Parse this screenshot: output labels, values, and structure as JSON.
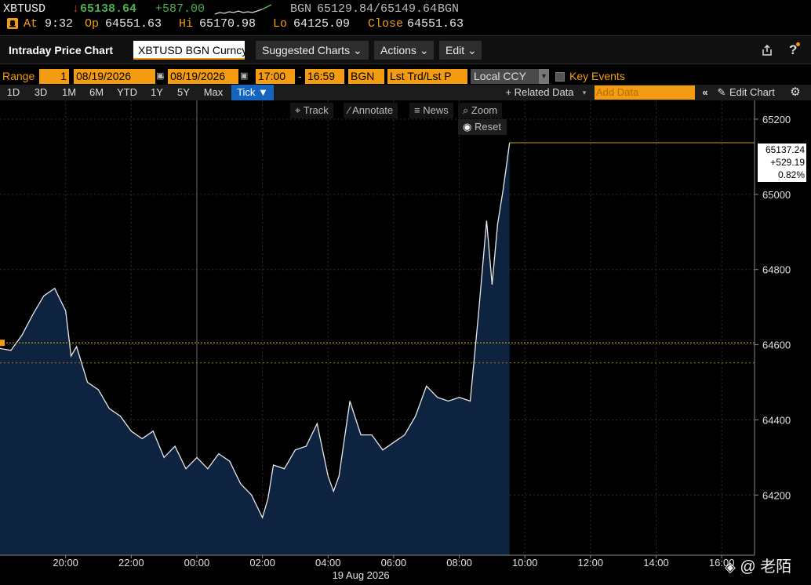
{
  "ticker": {
    "symbol": "XBTUSD",
    "arrow": "↓",
    "last": "65138.64",
    "change": "+587.00",
    "source": "BGN",
    "bid_ask": "65129.84/65149.64",
    "source2": "BGN",
    "at_label": "At",
    "at_time": "9:32",
    "open_label": "Op",
    "open": "64551.63",
    "high_label": "Hi",
    "high": "65170.98",
    "low_label": "Lo",
    "low": "64125.09",
    "close_label": "Close",
    "close": "64551.63"
  },
  "titlebar": {
    "title": "Intraday Price Chart",
    "security": "XBTUSD BGN Curncy",
    "suggested": "Suggested Charts",
    "actions": "Actions",
    "edit": "Edit",
    "help": "?"
  },
  "rangebar": {
    "range_label": "Range",
    "range_num": "1",
    "date_start": "08/19/2026",
    "date_sep": "-",
    "date_end": "08/19/2026",
    "time_start": "17:00",
    "time_sep": "-",
    "time_end": "16:59",
    "source": "BGN",
    "mode": "Lst Trd/Lst P",
    "ccy": "Local CCY",
    "key_events": "Key Events"
  },
  "periodbar": {
    "periods": [
      "1D",
      "3D",
      "1M",
      "6M",
      "YTD",
      "1Y",
      "5Y",
      "Max"
    ],
    "active": "Tick ▼",
    "related": "+ Related Data",
    "add_data_placeholder": "Add Data",
    "edit_chart": "Edit Chart"
  },
  "tools": {
    "track": "Track",
    "annotate": "Annotate",
    "news": "News",
    "zoom": "Zoom",
    "reset": "Reset"
  },
  "watermark": "@ 老陌",
  "colors": {
    "accent_orange": "#f39c12",
    "last_price_line": "#d4a017",
    "area_fill": "#0e2340",
    "price_line": "#e8e8e8",
    "up_green": "#4caf50",
    "down_red": "#e03a2e"
  },
  "chart_data": {
    "type": "area",
    "series": [
      {
        "x": [
          "18:00",
          "18:20",
          "18:40",
          "19:00",
          "19:20",
          "19:40",
          "20:00",
          "20:10",
          "20:20",
          "20:40",
          "21:00",
          "21:20",
          "21:40",
          "22:00",
          "22:20",
          "22:40",
          "23:00",
          "23:20",
          "23:40",
          "00:00",
          "00:20",
          "00:40",
          "01:00",
          "01:20",
          "01:40",
          "02:00",
          "02:10",
          "02:20",
          "02:40",
          "03:00",
          "03:20",
          "03:40",
          "04:00",
          "04:10",
          "04:20",
          "04:40",
          "05:00",
          "05:20",
          "05:40",
          "06:00",
          "06:20",
          "06:40",
          "07:00",
          "07:20",
          "07:40",
          "08:00",
          "08:20",
          "08:35",
          "08:50",
          "09:00",
          "09:10",
          "09:20",
          "09:32"
        ],
        "values": [
          64590,
          64585,
          64625,
          64680,
          64730,
          64750,
          64690,
          64570,
          64595,
          64500,
          64480,
          64430,
          64410,
          64370,
          64350,
          64370,
          64300,
          64330,
          64270,
          64300,
          64270,
          64310,
          64290,
          64230,
          64200,
          64140,
          64190,
          64280,
          64270,
          64320,
          64330,
          64390,
          64250,
          64210,
          64250,
          64450,
          64360,
          64360,
          64320,
          64340,
          64360,
          64410,
          64490,
          64460,
          64450,
          64460,
          64450,
          64680,
          64930,
          64760,
          64920,
          65010,
          65137.24
        ]
      }
    ],
    "prev_close": 64605,
    "open_ref": 64551.63,
    "last_label": {
      "price": "65137.24",
      "change": "+529.19",
      "pct": "0.82%"
    },
    "y_ticks": [
      65200,
      65000,
      64800,
      64600,
      64400,
      64200
    ],
    "x_ticks": [
      "20:00",
      "22:00",
      "00:00",
      "02:00",
      "04:00",
      "06:00",
      "08:00",
      "10:00",
      "12:00",
      "14:00",
      "16:00"
    ],
    "x_sublabel": "19 Aug 2026",
    "ylim": [
      64040,
      65250
    ],
    "xlim_hours": [
      18.0,
      41.0
    ],
    "session_start": "00:00",
    "title": "",
    "xlabel": "",
    "ylabel": ""
  }
}
